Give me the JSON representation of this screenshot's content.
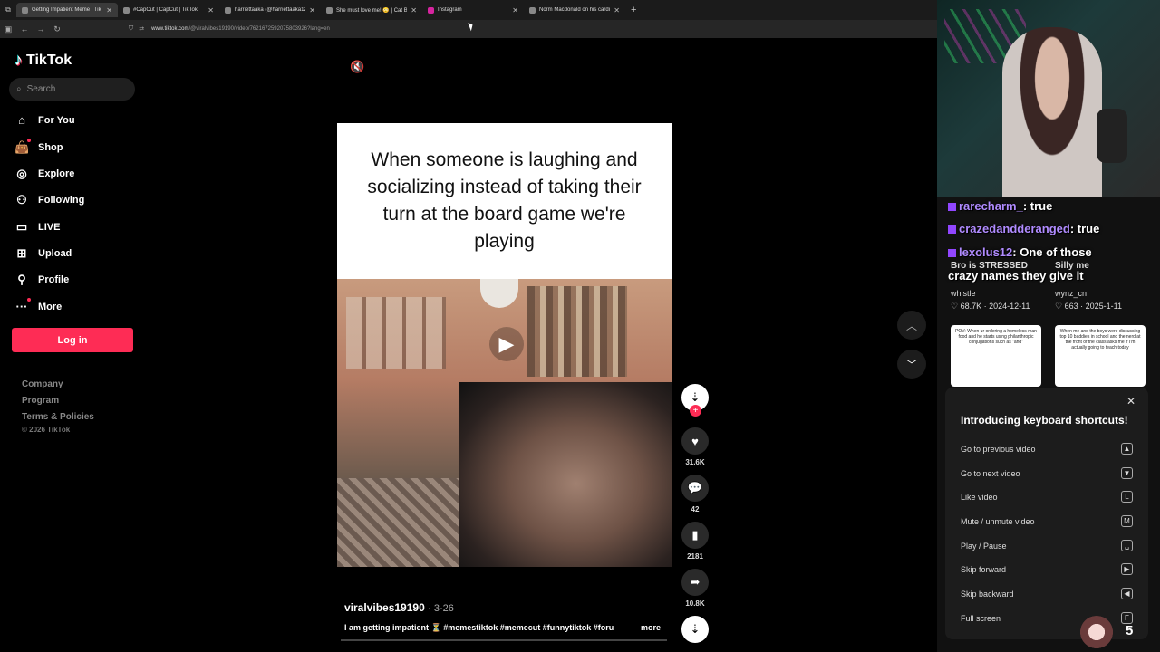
{
  "browser": {
    "tabs": [
      {
        "label": "Getting Impatient Meme | TikTok",
        "active": true
      },
      {
        "label": "#CapCut | CapCut | TikTok"
      },
      {
        "label": "harriettaaka (@harriettaaka129)"
      },
      {
        "label": "She must love me! 😳 | Cat Bait"
      },
      {
        "label": "Instagram"
      },
      {
        "label": "Norm Macdonald on his cardio"
      }
    ],
    "url_host": "www.tiktok.com",
    "url_path": "/@viralvibes19190/video/7621672592075803926?lang=en"
  },
  "sidebar": {
    "brand": "TikTok",
    "search_placeholder": "Search",
    "nav": [
      {
        "label": "For You",
        "icon": "home-icon"
      },
      {
        "label": "Shop",
        "icon": "shop-icon"
      },
      {
        "label": "Explore",
        "icon": "compass-icon"
      },
      {
        "label": "Following",
        "icon": "following-icon"
      },
      {
        "label": "LIVE",
        "icon": "live-icon"
      },
      {
        "label": "Upload",
        "icon": "upload-icon"
      },
      {
        "label": "Profile",
        "icon": "profile-icon"
      },
      {
        "label": "More",
        "icon": "more-icon"
      }
    ],
    "login": "Log in",
    "footer": [
      "Company",
      "Program",
      "Terms & Policies"
    ],
    "copyright": "© 2026 TikTok"
  },
  "video": {
    "caption_text": "When someone is laughing and socializing instead of taking their turn at the board game we're playing",
    "author": "viralvibes19190",
    "date": "· 3-26",
    "description": "I am getting impatient ⏳ #memestiktok #memecut #funnytiktok #foru",
    "more": "more",
    "likes": "31.6K",
    "comments": "42",
    "saves": "2181",
    "shares": "10.8K"
  },
  "stream": {
    "chat": [
      {
        "user": "rarecharm_",
        "message": ": true"
      },
      {
        "user": "crazedandderanged",
        "message": ": true"
      },
      {
        "user": "lexolus12",
        "message": ": One of those"
      },
      {
        "user": "",
        "message": "crazy names they give it"
      }
    ],
    "cards": [
      {
        "title": "Bro is STRESSED",
        "author": "whistle",
        "likes": "68.7K",
        "date": "2024-12-11"
      },
      {
        "title": "Silly me",
        "author": "wynz_cn",
        "likes": "663",
        "date": "2025-1-11"
      }
    ],
    "thumb_texts": [
      "POV: When ur ordering a homeless man food and he starts using philanthropic conjugations such as \"and\"",
      "When me and the boys were discussing top 10 baddies in school and the nerd at the front of the class asks me if I'm actually going to teach today"
    ],
    "sub_count": "5"
  },
  "shortcuts": {
    "title": "Introducing keyboard shortcuts!",
    "items": [
      {
        "label": "Go to previous video",
        "key": "▲"
      },
      {
        "label": "Go to next video",
        "key": "▼"
      },
      {
        "label": "Like video",
        "key": "L"
      },
      {
        "label": "Mute / unmute video",
        "key": "M"
      },
      {
        "label": "Play / Pause",
        "key": "␣"
      },
      {
        "label": "Skip forward",
        "key": "▶"
      },
      {
        "label": "Skip backward",
        "key": "◀"
      },
      {
        "label": "Full screen",
        "key": "F"
      }
    ]
  },
  "colors": {
    "accent": "#fe2c55",
    "background": "#000000",
    "panel": "#1c1c1c"
  }
}
